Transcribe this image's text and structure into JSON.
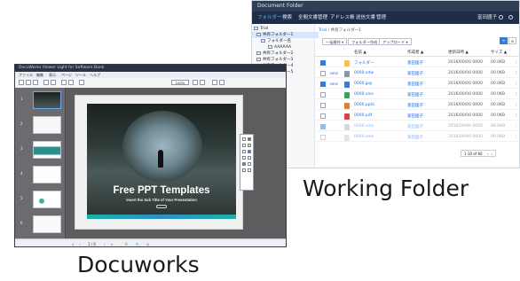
{
  "working_folder": {
    "window_title": "Document Folder",
    "menu": [
      "フォルダー",
      "検索",
      "全閲文書管理",
      "アドレス帳",
      "送信文書",
      "管理"
    ],
    "user": "富田國子",
    "tree": [
      {
        "label": "Trial"
      },
      {
        "label": "共有フォルダー1"
      },
      {
        "label": "フォルダー名"
      },
      {
        "label": "AAAAAA"
      },
      {
        "label": "共有フォルダー2"
      },
      {
        "label": "共有フォルダー3"
      },
      {
        "label": "共有フォルダー4"
      },
      {
        "label": "共有フォルダー5"
      }
    ],
    "breadcrumb": {
      "root": "Trial",
      "sep": "/",
      "current": "共有フォルダー1"
    },
    "toolbar": {
      "add": "一括操作 ▾",
      "new_folder": "フォルダー作成",
      "upload": "アップロード ▾"
    },
    "view_toggle": [
      "≡",
      "⊞"
    ],
    "columns": {
      "name": "名前 ▲",
      "owner": "作成者 ▲",
      "updated": "更新日時 ▲",
      "size": "サイズ ▲"
    },
    "rows": [
      {
        "new": "",
        "name": "フォルダー",
        "owner": "富田國子",
        "updated": "2016/00/00 0000",
        "size": "00.0KB",
        "checked": true,
        "icon_color": "#f2c14e"
      },
      {
        "new": "NEW",
        "name": "0000.xdw",
        "owner": "富田國子",
        "updated": "2016/00/00 0000",
        "size": "00.0KB",
        "checked": false,
        "icon_color": "#8a97a8"
      },
      {
        "new": "NEW",
        "name": "0000.jpg",
        "owner": "富田國子",
        "updated": "2016/00/00 0000",
        "size": "00.0KB",
        "checked": true,
        "icon_color": "#3a7bd5"
      },
      {
        "new": "",
        "name": "0000.xlsx",
        "owner": "富田國子",
        "updated": "2016/00/00 0000",
        "size": "00.0KB",
        "checked": false,
        "icon_color": "#3aa05a"
      },
      {
        "new": "",
        "name": "0000.pptx",
        "owner": "富田國子",
        "updated": "2016/00/00 0000",
        "size": "00.0KB",
        "checked": false,
        "icon_color": "#e07b39"
      },
      {
        "new": "",
        "name": "0000.pdf",
        "owner": "富田國子",
        "updated": "2016/00/00 0000",
        "size": "00.0KB",
        "checked": false,
        "icon_color": "#d64541"
      },
      {
        "new": "",
        "name": "0000.xdw",
        "owner": "富田國子",
        "updated": "2016/00/00 0000",
        "size": "00.0KB",
        "checked": true,
        "icon_color": "#aab4c2"
      },
      {
        "new": "",
        "name": "0000.xdw",
        "owner": "富田國子",
        "updated": "2016/00/00 0000",
        "size": "00.0KB",
        "checked": false,
        "icon_color": "#c4cbd5"
      }
    ],
    "pager": "1-10 of 60",
    "caption": "Working Folder"
  },
  "docuworks": {
    "window_title": "DocuWorks Viewer Light for Software Bank",
    "menu": [
      "ファイル",
      "編集",
      "表示",
      "ページ",
      "ツール",
      "ヘルプ"
    ],
    "zoom": "100%",
    "thumbnails": [
      "1",
      "2",
      "3",
      "4",
      "5",
      "6"
    ],
    "slide": {
      "title": "Free PPT Templates",
      "subtitle": "Insert the Sub Title of Your Presentation"
    },
    "status_page": "1 / 6",
    "caption": "Docuworks"
  },
  "icons": {
    "search": "search-icon",
    "help": "help-icon",
    "user": "user-icon",
    "folder": "folder-icon"
  }
}
